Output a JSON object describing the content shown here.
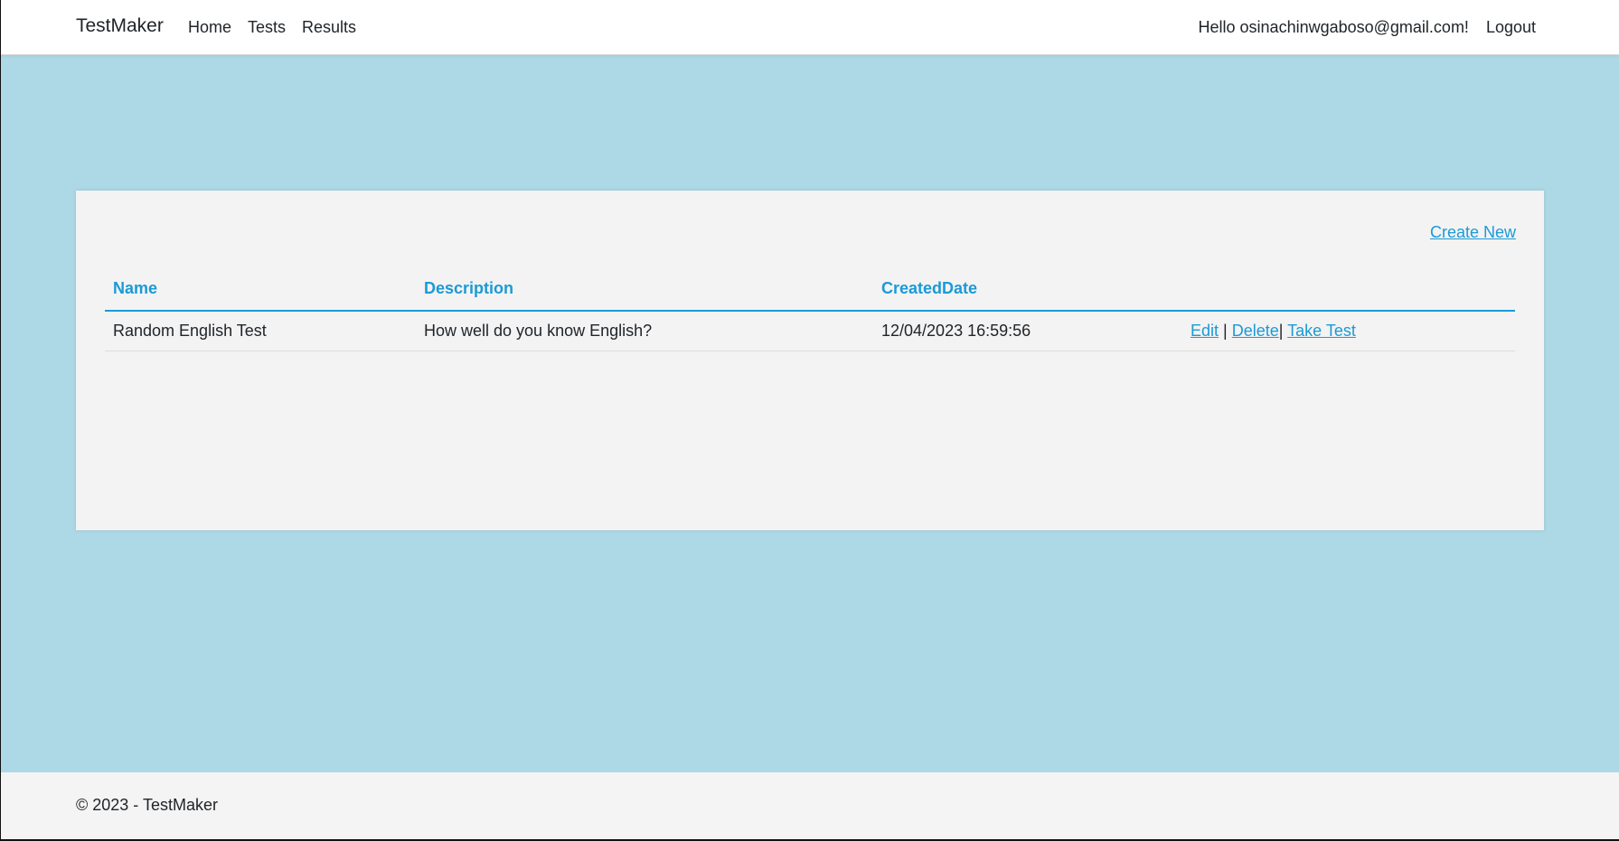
{
  "navbar": {
    "brand": "TestMaker",
    "links": [
      "Home",
      "Tests",
      "Results"
    ],
    "greeting": "Hello osinachinwgaboso@gmail.com!",
    "logout": "Logout"
  },
  "page": {
    "create_new": "Create New",
    "table": {
      "headers": [
        "Name",
        "Description",
        "CreatedDate"
      ],
      "rows": [
        {
          "name": "Random English Test",
          "description": "How well do you know English?",
          "created_date": "12/04/2023 16:59:56",
          "actions": {
            "edit": "Edit",
            "sep1": "|",
            "delete": "Delete",
            "sep2": "|",
            "take_test": "Take Test"
          }
        }
      ]
    }
  },
  "footer": {
    "text": "© 2023 - TestMaker"
  },
  "colors": {
    "background": "#add8e6",
    "accent": "#1b9ad6",
    "card": "#f3f3f3"
  }
}
